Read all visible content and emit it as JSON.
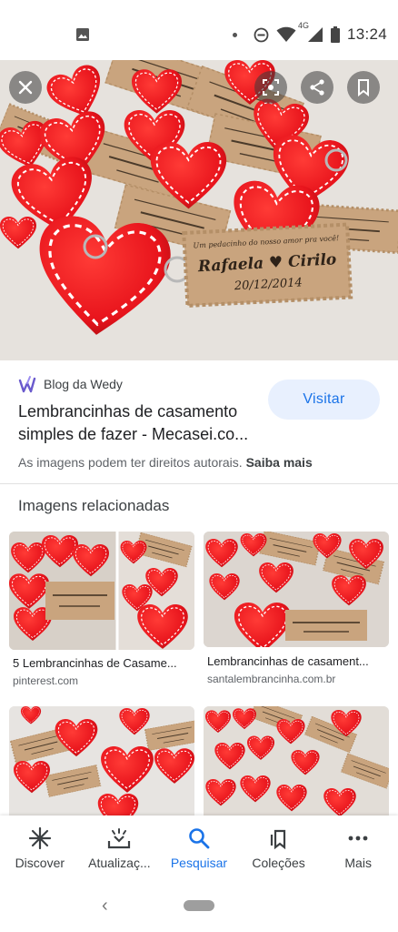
{
  "status_bar": {
    "time": "13:24",
    "network": "4G",
    "icons": [
      "gallery-icon",
      "dnd-icon",
      "wifi-icon",
      "signal-icon",
      "battery-icon"
    ]
  },
  "hero": {
    "tag_text": {
      "line1": "Um pedacinho do nosso amor pra você!",
      "names": "Rafaela ♥ Cirilo",
      "date": "20/12/2014"
    }
  },
  "result": {
    "source_name": "Blog da Wedy",
    "title": "Lembrancinhas de casamento simples de fazer - Mecasei.co...",
    "visit_label": "Visitar",
    "copyright_text": "As imagens podem ter direitos autorais.",
    "copyright_more": "Saiba mais"
  },
  "related": {
    "heading": "Imagens relacionadas",
    "items": [
      {
        "caption": "5 Lembrancinhas de Casame...",
        "domain": "pinterest.com"
      },
      {
        "caption": "Lembrancinhas de casament...",
        "domain": "santalembrancinha.com.br"
      },
      {
        "caption": "",
        "domain": ""
      },
      {
        "caption": "",
        "domain": ""
      }
    ]
  },
  "bottom_nav": {
    "items": [
      {
        "label": "Discover",
        "icon": "asterisk-icon"
      },
      {
        "label": "Atualizaç...",
        "icon": "updates-icon"
      },
      {
        "label": "Pesquisar",
        "icon": "search-icon",
        "active": true
      },
      {
        "label": "Coleções",
        "icon": "collections-icon"
      },
      {
        "label": "Mais",
        "icon": "more-icon"
      }
    ]
  },
  "colors": {
    "accent": "#1a73e8",
    "visit_bg": "#e8f0fe",
    "felt_red": "#e8141c",
    "kraft": "#c9a47e"
  }
}
